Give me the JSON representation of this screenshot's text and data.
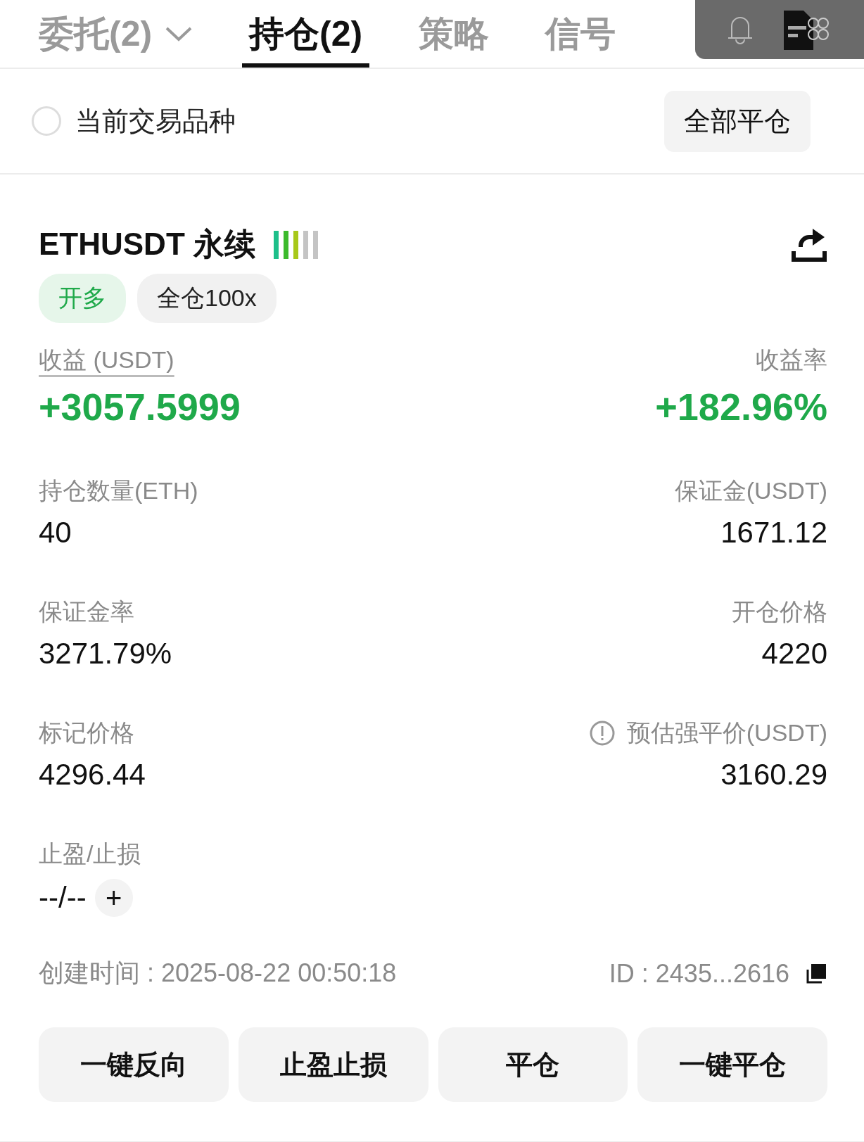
{
  "tabs": [
    {
      "label": "委托(2)",
      "selected": false,
      "dropdown": true
    },
    {
      "label": "持仓(2)",
      "selected": true,
      "dropdown": false
    },
    {
      "label": "策略",
      "selected": false,
      "dropdown": false
    },
    {
      "label": "信号",
      "selected": false,
      "dropdown": false
    }
  ],
  "filter": {
    "label": "当前交易品种",
    "checked": false
  },
  "close_all_button": "全部平仓",
  "position": {
    "symbol": "ETHUSDT 永续",
    "adl": {
      "level": 0.6
    },
    "tags": [
      {
        "label": "开多",
        "kind": "side"
      },
      {
        "label": "全仓100x",
        "kind": "mode"
      }
    ],
    "pnl": {
      "label": "收益 (USDT)",
      "value": "+3057.5999"
    },
    "roi": {
      "label": "收益率",
      "value": "+182.96%"
    },
    "fields": [
      {
        "label": "持仓数量(ETH)",
        "value": "40",
        "info": false
      },
      {
        "label": "保证金(USDT)",
        "value": "1671.12",
        "info": false
      },
      {
        "label": "保证金率",
        "value": "3271.79%",
        "info": false
      },
      {
        "label": "开仓价格",
        "value": "4220",
        "info": false
      },
      {
        "label": "标记价格",
        "value": "4296.44",
        "info": false
      },
      {
        "label": "预估强平价(USDT)",
        "value": "3160.29",
        "info": true
      }
    ],
    "tpsl": {
      "label": "止盈/止损",
      "value": "--/--",
      "add": "+"
    },
    "created": "创建时间 : 2025-08-22 00:50:18",
    "id": "ID : 2435...2616",
    "actions": [
      "一键反向",
      "止盈止损",
      "平仓",
      "一键平仓"
    ]
  }
}
